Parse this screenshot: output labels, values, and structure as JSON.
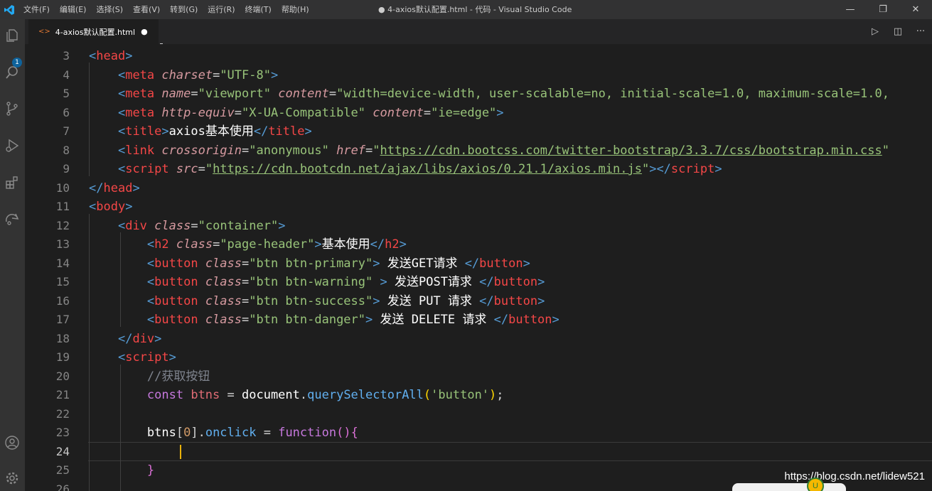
{
  "window": {
    "title": "● 4-axios默认配置.html - 代码 - Visual Studio Code",
    "menu": [
      "文件(F)",
      "编辑(E)",
      "选择(S)",
      "查看(V)",
      "转到(G)",
      "运行(R)",
      "终端(T)",
      "帮助(H)"
    ],
    "controls": {
      "minimize": "—",
      "restore": "❐",
      "close": "✕"
    }
  },
  "activitybar": {
    "icons": [
      "explorer-icon",
      "search-icon",
      "source-control-icon",
      "run-debug-icon",
      "extensions-icon",
      "remote-icon",
      "account-icon",
      "settings-gear-icon"
    ],
    "explorer_badge": "1"
  },
  "tab": {
    "label": "4-axios默认配置.html",
    "icon": "<>",
    "dirty": "●"
  },
  "editor_actions": {
    "run": "▷",
    "split": "◫",
    "more": "···"
  },
  "editor": {
    "line_numbers": [
      "3",
      "4",
      "5",
      "6",
      "7",
      "8",
      "9",
      "10",
      "11",
      "12",
      "13",
      "14",
      "15",
      "16",
      "17",
      "18",
      "19",
      "20",
      "21",
      "22",
      "23",
      "24",
      "25",
      "26"
    ],
    "active_line": "24",
    "lines": [
      [
        [
          "t",
          "<"
        ],
        [
          "tg",
          "head"
        ],
        [
          "t",
          ">"
        ]
      ],
      [
        [
          "pn",
          "    "
        ],
        [
          "t",
          "<"
        ],
        [
          "tg",
          "meta"
        ],
        [
          "pn",
          " "
        ],
        [
          "at",
          "charset"
        ],
        [
          "eq",
          "="
        ],
        [
          "st",
          "\"UTF-8\""
        ],
        [
          "t",
          ">"
        ]
      ],
      [
        [
          "pn",
          "    "
        ],
        [
          "t",
          "<"
        ],
        [
          "tg",
          "meta"
        ],
        [
          "pn",
          " "
        ],
        [
          "at",
          "name"
        ],
        [
          "eq",
          "="
        ],
        [
          "st",
          "\"viewport\""
        ],
        [
          "pn",
          " "
        ],
        [
          "at",
          "content"
        ],
        [
          "eq",
          "="
        ],
        [
          "st",
          "\"width=device-width, user-scalable=no, initial-scale=1.0, maximum-scale=1.0,"
        ]
      ],
      [
        [
          "pn",
          "    "
        ],
        [
          "t",
          "<"
        ],
        [
          "tg",
          "meta"
        ],
        [
          "pn",
          " "
        ],
        [
          "at",
          "http-equiv"
        ],
        [
          "eq",
          "="
        ],
        [
          "st",
          "\"X-UA-Compatible\""
        ],
        [
          "pn",
          " "
        ],
        [
          "at",
          "content"
        ],
        [
          "eq",
          "="
        ],
        [
          "st",
          "\"ie=edge\""
        ],
        [
          "t",
          ">"
        ]
      ],
      [
        [
          "pn",
          "    "
        ],
        [
          "t",
          "<"
        ],
        [
          "tg",
          "title"
        ],
        [
          "t",
          ">"
        ],
        [
          "tx",
          "axios基本使用"
        ],
        [
          "t",
          "</"
        ],
        [
          "tg",
          "title"
        ],
        [
          "t",
          ">"
        ]
      ],
      [
        [
          "pn",
          "    "
        ],
        [
          "t",
          "<"
        ],
        [
          "tg",
          "link"
        ],
        [
          "pn",
          " "
        ],
        [
          "at",
          "crossorigin"
        ],
        [
          "eq",
          "="
        ],
        [
          "st",
          "\"anonymous\""
        ],
        [
          "pn",
          " "
        ],
        [
          "at",
          "href"
        ],
        [
          "eq",
          "="
        ],
        [
          "st",
          "\""
        ],
        [
          "ur",
          "https://cdn.bootcss.com/twitter-bootstrap/3.3.7/css/bootstrap.min.css"
        ],
        [
          "st",
          "\""
        ]
      ],
      [
        [
          "pn",
          "    "
        ],
        [
          "t",
          "<"
        ],
        [
          "tg",
          "script"
        ],
        [
          "pn",
          " "
        ],
        [
          "at",
          "src"
        ],
        [
          "eq",
          "="
        ],
        [
          "st",
          "\""
        ],
        [
          "ur",
          "https://cdn.bootcdn.net/ajax/libs/axios/0.21.1/axios.min.js"
        ],
        [
          "st",
          "\""
        ],
        [
          "t",
          "></"
        ],
        [
          "tg",
          "script"
        ],
        [
          "t",
          ">"
        ]
      ],
      [
        [
          "t",
          "</"
        ],
        [
          "tg",
          "head"
        ],
        [
          "t",
          ">"
        ]
      ],
      [
        [
          "t",
          "<"
        ],
        [
          "tg",
          "body"
        ],
        [
          "t",
          ">"
        ]
      ],
      [
        [
          "pn",
          "    "
        ],
        [
          "t",
          "<"
        ],
        [
          "tg",
          "div"
        ],
        [
          "pn",
          " "
        ],
        [
          "at",
          "class"
        ],
        [
          "eq",
          "="
        ],
        [
          "st",
          "\"container\""
        ],
        [
          "t",
          ">"
        ]
      ],
      [
        [
          "pn",
          "        "
        ],
        [
          "t",
          "<"
        ],
        [
          "tg",
          "h2"
        ],
        [
          "pn",
          " "
        ],
        [
          "at",
          "class"
        ],
        [
          "eq",
          "="
        ],
        [
          "st",
          "\"page-header\""
        ],
        [
          "t",
          ">"
        ],
        [
          "tx",
          "基本使用"
        ],
        [
          "t",
          "</"
        ],
        [
          "tg",
          "h2"
        ],
        [
          "t",
          ">"
        ]
      ],
      [
        [
          "pn",
          "        "
        ],
        [
          "t",
          "<"
        ],
        [
          "tg",
          "button"
        ],
        [
          "pn",
          " "
        ],
        [
          "at",
          "class"
        ],
        [
          "eq",
          "="
        ],
        [
          "st",
          "\"btn btn-primary\""
        ],
        [
          "t",
          ">"
        ],
        [
          "tx",
          " 发送GET请求 "
        ],
        [
          "t",
          "</"
        ],
        [
          "tg",
          "button"
        ],
        [
          "t",
          ">"
        ]
      ],
      [
        [
          "pn",
          "        "
        ],
        [
          "t",
          "<"
        ],
        [
          "tg",
          "button"
        ],
        [
          "pn",
          " "
        ],
        [
          "at",
          "class"
        ],
        [
          "eq",
          "="
        ],
        [
          "st",
          "\"btn btn-warning\""
        ],
        [
          "pn",
          " "
        ],
        [
          "t",
          ">"
        ],
        [
          "tx",
          " 发送POST请求 "
        ],
        [
          "t",
          "</"
        ],
        [
          "tg",
          "button"
        ],
        [
          "t",
          ">"
        ]
      ],
      [
        [
          "pn",
          "        "
        ],
        [
          "t",
          "<"
        ],
        [
          "tg",
          "button"
        ],
        [
          "pn",
          " "
        ],
        [
          "at",
          "class"
        ],
        [
          "eq",
          "="
        ],
        [
          "st",
          "\"btn btn-success\""
        ],
        [
          "t",
          ">"
        ],
        [
          "tx",
          " 发送 PUT 请求 "
        ],
        [
          "t",
          "</"
        ],
        [
          "tg",
          "button"
        ],
        [
          "t",
          ">"
        ]
      ],
      [
        [
          "pn",
          "        "
        ],
        [
          "t",
          "<"
        ],
        [
          "tg",
          "button"
        ],
        [
          "pn",
          " "
        ],
        [
          "at",
          "class"
        ],
        [
          "eq",
          "="
        ],
        [
          "st",
          "\"btn btn-danger\""
        ],
        [
          "t",
          ">"
        ],
        [
          "tx",
          " 发送 DELETE 请求 "
        ],
        [
          "t",
          "</"
        ],
        [
          "tg",
          "button"
        ],
        [
          "t",
          ">"
        ]
      ],
      [
        [
          "pn",
          "    "
        ],
        [
          "t",
          "</"
        ],
        [
          "tg",
          "div"
        ],
        [
          "t",
          ">"
        ]
      ],
      [
        [
          "pn",
          "    "
        ],
        [
          "t",
          "<"
        ],
        [
          "tg",
          "script"
        ],
        [
          "t",
          ">"
        ]
      ],
      [
        [
          "pn",
          "        "
        ],
        [
          "cm",
          "//获取按钮"
        ]
      ],
      [
        [
          "pn",
          "        "
        ],
        [
          "kw",
          "const"
        ],
        [
          "pn",
          " "
        ],
        [
          "vr",
          "btns"
        ],
        [
          "pn",
          " = "
        ],
        [
          "tx",
          "document"
        ],
        [
          "pn",
          "."
        ],
        [
          "fn",
          "querySelectorAll"
        ],
        [
          "br",
          "("
        ],
        [
          "st",
          "'button'"
        ],
        [
          "br",
          ")"
        ],
        [
          "pn",
          ";"
        ]
      ],
      [],
      [
        [
          "pn",
          "        "
        ],
        [
          "tx",
          "btns"
        ],
        [
          "pn",
          "["
        ],
        [
          "nm",
          "0"
        ],
        [
          "pn",
          "]."
        ],
        [
          "fn",
          "onclick"
        ],
        [
          "pn",
          " = "
        ],
        [
          "kw",
          "function"
        ],
        [
          "br2",
          "()"
        ],
        [
          "br2",
          "{"
        ]
      ],
      [],
      [
        [
          "pn",
          "        "
        ],
        [
          "br2",
          "}"
        ]
      ],
      []
    ]
  },
  "watermark": "https://blog.csdn.net/lidew521",
  "colors": {
    "editor_bg": "#1e1e1e",
    "titlebar_bg": "#323233",
    "activitybar_bg": "#333333",
    "tabbar_bg": "#252526",
    "cursor": "#e9b20a"
  }
}
